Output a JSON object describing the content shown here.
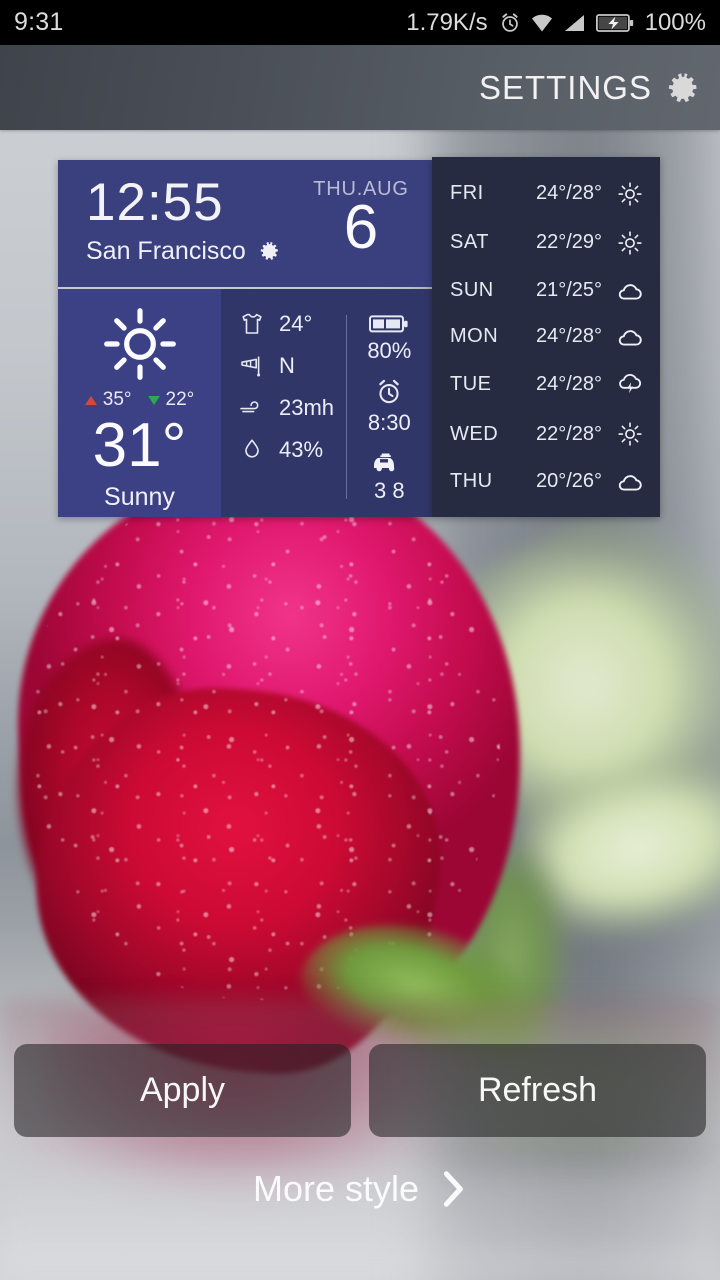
{
  "status_bar": {
    "time": "9:31",
    "network_speed": "1.79K/s",
    "battery_percent": "100%",
    "icons": [
      "alarm-clock-icon",
      "wifi-icon",
      "signal-icon",
      "battery-charging-icon"
    ]
  },
  "header": {
    "settings_label": "SETTINGS",
    "gear_icon": "gear-icon"
  },
  "widget": {
    "clock": {
      "time": "12:55",
      "city": "San Francisco",
      "city_settings_icon": "gear-icon",
      "day_of_week_month": "THU.AUG",
      "day_number": "6"
    },
    "current": {
      "condition_icon": "sun-icon",
      "high": "35°",
      "low": "22°",
      "temperature": "31°",
      "condition": "Sunny"
    },
    "details": [
      {
        "icon": "tshirt-icon",
        "value": "24°"
      },
      {
        "icon": "windsock-icon",
        "value": "N"
      },
      {
        "icon": "wind-icon",
        "value": "23mh"
      },
      {
        "icon": "droplet-icon",
        "value": "43%"
      }
    ],
    "status": [
      {
        "icon": "battery-icon",
        "value": "80%"
      },
      {
        "icon": "alarm-clock-icon",
        "value": "8:30"
      },
      {
        "icon": "car-icon",
        "value": "3 8"
      }
    ]
  },
  "forecast": [
    {
      "day": "FRI",
      "temps": "24°/28°",
      "icon": "sun-icon"
    },
    {
      "day": "SAT",
      "temps": "22°/29°",
      "icon": "sun-icon"
    },
    {
      "day": "SUN",
      "temps": "21°/25°",
      "icon": "cloud-icon"
    },
    {
      "day": "MON",
      "temps": "24°/28°",
      "icon": "cloud-icon"
    },
    {
      "day": "TUE",
      "temps": "24°/28°",
      "icon": "thunderstorm-icon"
    },
    {
      "day": "WED",
      "temps": "22°/28°",
      "icon": "sun-icon"
    },
    {
      "day": "THU",
      "temps": "20°/26°",
      "icon": "cloud-icon"
    }
  ],
  "actions": {
    "apply_label": "Apply",
    "refresh_label": "Refresh",
    "more_style_label": "More style",
    "more_style_icon": "chevron-right-icon"
  },
  "colors": {
    "clock_panel": "#3a3f7d",
    "now_panel": "#3c4186",
    "detail_panel": "#313668",
    "forecast_panel": "#262b41",
    "status_bar": "#000000",
    "high_marker": "#d8463c",
    "low_marker": "#2ea84f"
  }
}
